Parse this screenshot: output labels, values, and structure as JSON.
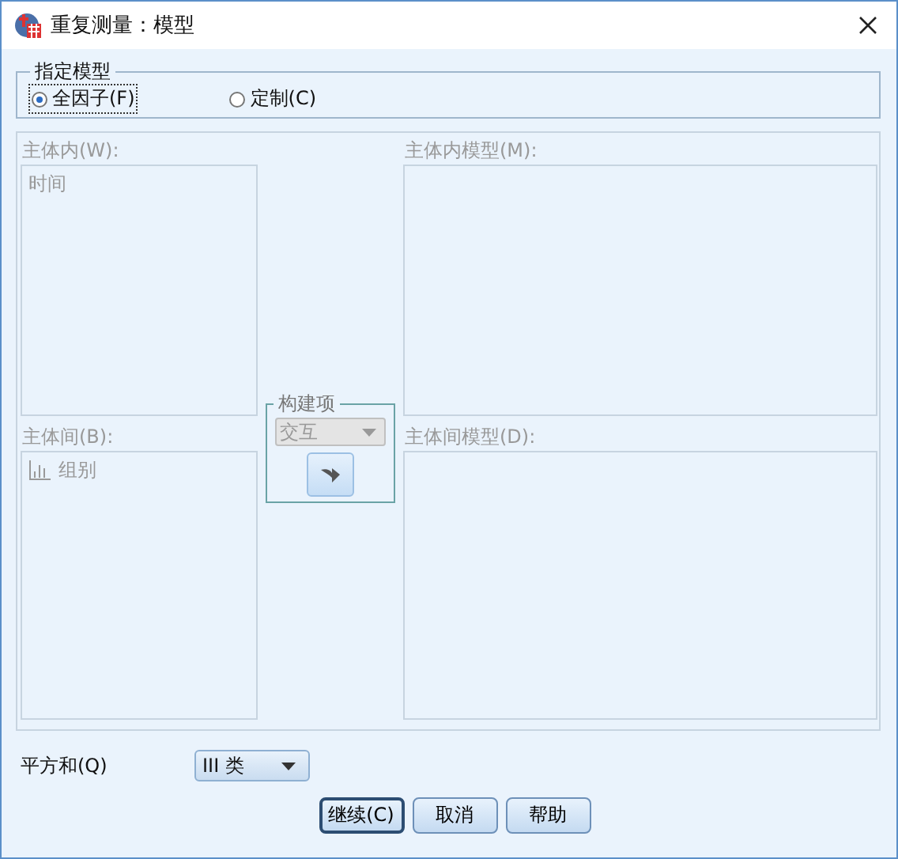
{
  "window": {
    "title": "重复测量：模型"
  },
  "model_spec": {
    "legend": "指定模型",
    "options": [
      {
        "label": "全因子(F)",
        "selected": true
      },
      {
        "label": "定制(C)",
        "selected": false
      }
    ]
  },
  "terms": {
    "disabled": true,
    "within": {
      "label": "主体内(W):",
      "items": [
        "时间"
      ]
    },
    "within_model": {
      "label": "主体内模型(M):"
    },
    "between": {
      "label": "主体间(B):",
      "items": [
        "组别"
      ]
    },
    "between_model": {
      "label": "主体间模型(D):"
    },
    "build": {
      "legend": "构建项",
      "type_value": "交互"
    }
  },
  "sum_of_squares": {
    "label": "平方和(Q)",
    "value": "III 类"
  },
  "buttons": [
    {
      "label": "继续(C)",
      "default": true
    },
    {
      "label": "取消",
      "default": false
    },
    {
      "label": "帮助",
      "default": false
    }
  ]
}
